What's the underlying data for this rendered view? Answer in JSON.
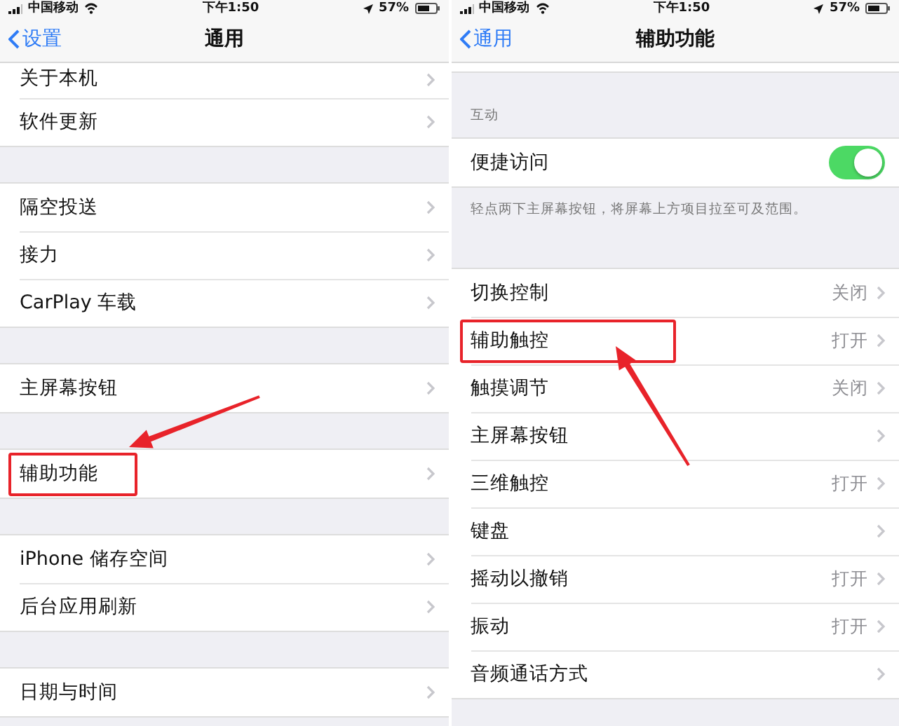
{
  "panels": [
    {
      "status_bar": {
        "carrier": "中国移动",
        "time": "下午1:50",
        "battery": "57%"
      },
      "nav": {
        "back": "设置",
        "title": "通用"
      },
      "sections": [
        {
          "rows": [
            {
              "kind": "link",
              "label": "关于本机",
              "highlighted": false
            },
            {
              "kind": "link",
              "label": "软件更新",
              "highlighted": false
            }
          ]
        },
        {
          "rows": [
            {
              "kind": "link",
              "label": "隔空投送",
              "highlighted": false
            },
            {
              "kind": "link",
              "label": "接力",
              "highlighted": false
            },
            {
              "kind": "link",
              "label": "CarPlay 车载",
              "highlighted": false
            }
          ]
        },
        {
          "rows": [
            {
              "kind": "link",
              "label": "主屏幕按钮",
              "highlighted": false
            }
          ]
        },
        {
          "rows": [
            {
              "kind": "link",
              "label": "辅助功能",
              "highlighted": true
            }
          ]
        },
        {
          "rows": [
            {
              "kind": "link",
              "label": "iPhone 储存空间",
              "highlighted": false
            },
            {
              "kind": "link",
              "label": "后台应用刷新",
              "highlighted": false
            }
          ]
        },
        {
          "rows": [
            {
              "kind": "link",
              "label": "日期与时间",
              "highlighted": false
            }
          ]
        }
      ]
    },
    {
      "status_bar": {
        "carrier": "中国移动",
        "time": "下午1:50",
        "battery": "57%"
      },
      "nav": {
        "back": "通用",
        "title": "辅助功能"
      },
      "sections": [
        {
          "header": "互动",
          "rows": [
            {
              "kind": "toggle",
              "label": "便捷访问",
              "on": true
            }
          ],
          "footer": "轻点两下主屏幕按钮，将屏幕上方项目拉至可及范围。"
        },
        {
          "rows": [
            {
              "kind": "link",
              "label": "切换控制",
              "value": "关闭",
              "highlighted": false
            },
            {
              "kind": "link",
              "label": "辅助触控",
              "value": "打开",
              "highlighted": true
            },
            {
              "kind": "link",
              "label": "触摸调节",
              "value": "关闭",
              "highlighted": false
            },
            {
              "kind": "link",
              "label": "主屏幕按钮",
              "highlighted": false
            },
            {
              "kind": "link",
              "label": "三维触控",
              "value": "打开",
              "highlighted": false
            },
            {
              "kind": "link",
              "label": "键盘",
              "highlighted": false
            },
            {
              "kind": "link",
              "label": "摇动以撤销",
              "value": "打开",
              "highlighted": false
            },
            {
              "kind": "link",
              "label": "振动",
              "value": "打开",
              "highlighted": false
            },
            {
              "kind": "link",
              "label": "音频通话方式",
              "highlighted": false
            }
          ]
        }
      ]
    }
  ]
}
